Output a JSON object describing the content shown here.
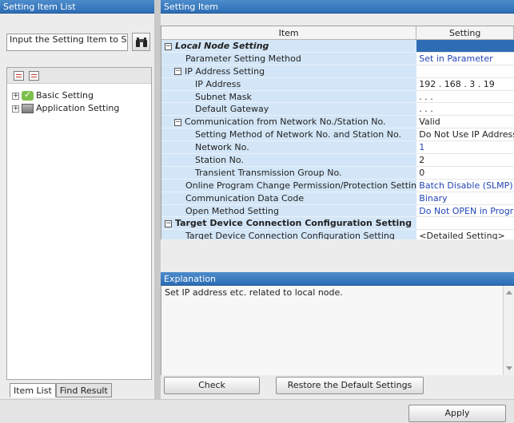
{
  "left_panel": {
    "title": "Setting Item List",
    "search_placeholder": "Input the Setting Item to Search",
    "tree": [
      {
        "label": "Basic Setting",
        "icon": "check-icon"
      },
      {
        "label": "Application Setting",
        "icon": "app-setting-icon"
      }
    ],
    "tabs": [
      "Item List",
      "Find Result"
    ]
  },
  "grid": {
    "title": "Setting Item",
    "columns": [
      "Item",
      "Setting"
    ],
    "rows": [
      {
        "item": "Local Node Setting",
        "setting": "",
        "level": 0,
        "section": true,
        "italic": true
      },
      {
        "item": "Parameter Setting Method",
        "setting": "Set in Parameter",
        "level": 1,
        "blue": true
      },
      {
        "item": "IP Address Setting",
        "setting": "",
        "level": 1,
        "group": true
      },
      {
        "item": "IP Address",
        "setting": "192 . 168 .   3 .  19",
        "level": 2
      },
      {
        "item": "Subnet Mask",
        "setting": "  .     .     .",
        "level": 2
      },
      {
        "item": "Default Gateway",
        "setting": "  .     .     .",
        "level": 2
      },
      {
        "item": "Communication from Network No./Station No.",
        "setting": "Valid",
        "level": 1,
        "group": true
      },
      {
        "item": "Setting Method of Network No. and Station No.",
        "setting": "Do Not Use IP Address",
        "level": 2
      },
      {
        "item": "Network No.",
        "setting": "1",
        "level": 2,
        "blue": true
      },
      {
        "item": "Station No.",
        "setting": "2",
        "level": 2
      },
      {
        "item": "Transient Transmission Group No.",
        "setting": "0",
        "level": 2
      },
      {
        "item": "Online Program Change Permission/Protection Setting",
        "setting": "Batch Disable (SLMP)",
        "level": 1,
        "blue": true
      },
      {
        "item": "Communication Data Code",
        "setting": "Binary",
        "level": 1,
        "blue": true
      },
      {
        "item": "Open Method Setting",
        "setting": "Do Not OPEN in Program",
        "level": 1,
        "blue": true
      },
      {
        "item": "Target Device Connection Configuration Setting",
        "setting": "",
        "level": 0,
        "section": true
      },
      {
        "item": "Target Device Connection Configuration Setting",
        "setting": "<Detailed Setting>",
        "level": 1
      }
    ]
  },
  "explanation": {
    "title": "Explanation",
    "text": "Set IP address etc. related to local node."
  },
  "buttons": {
    "check": "Check",
    "restore": "Restore the Default Settings",
    "apply": "Apply"
  },
  "colors": {
    "title_bar": "#2c6db5",
    "item_cell": "#d3e6f7",
    "link_blue": "#2345b5"
  }
}
